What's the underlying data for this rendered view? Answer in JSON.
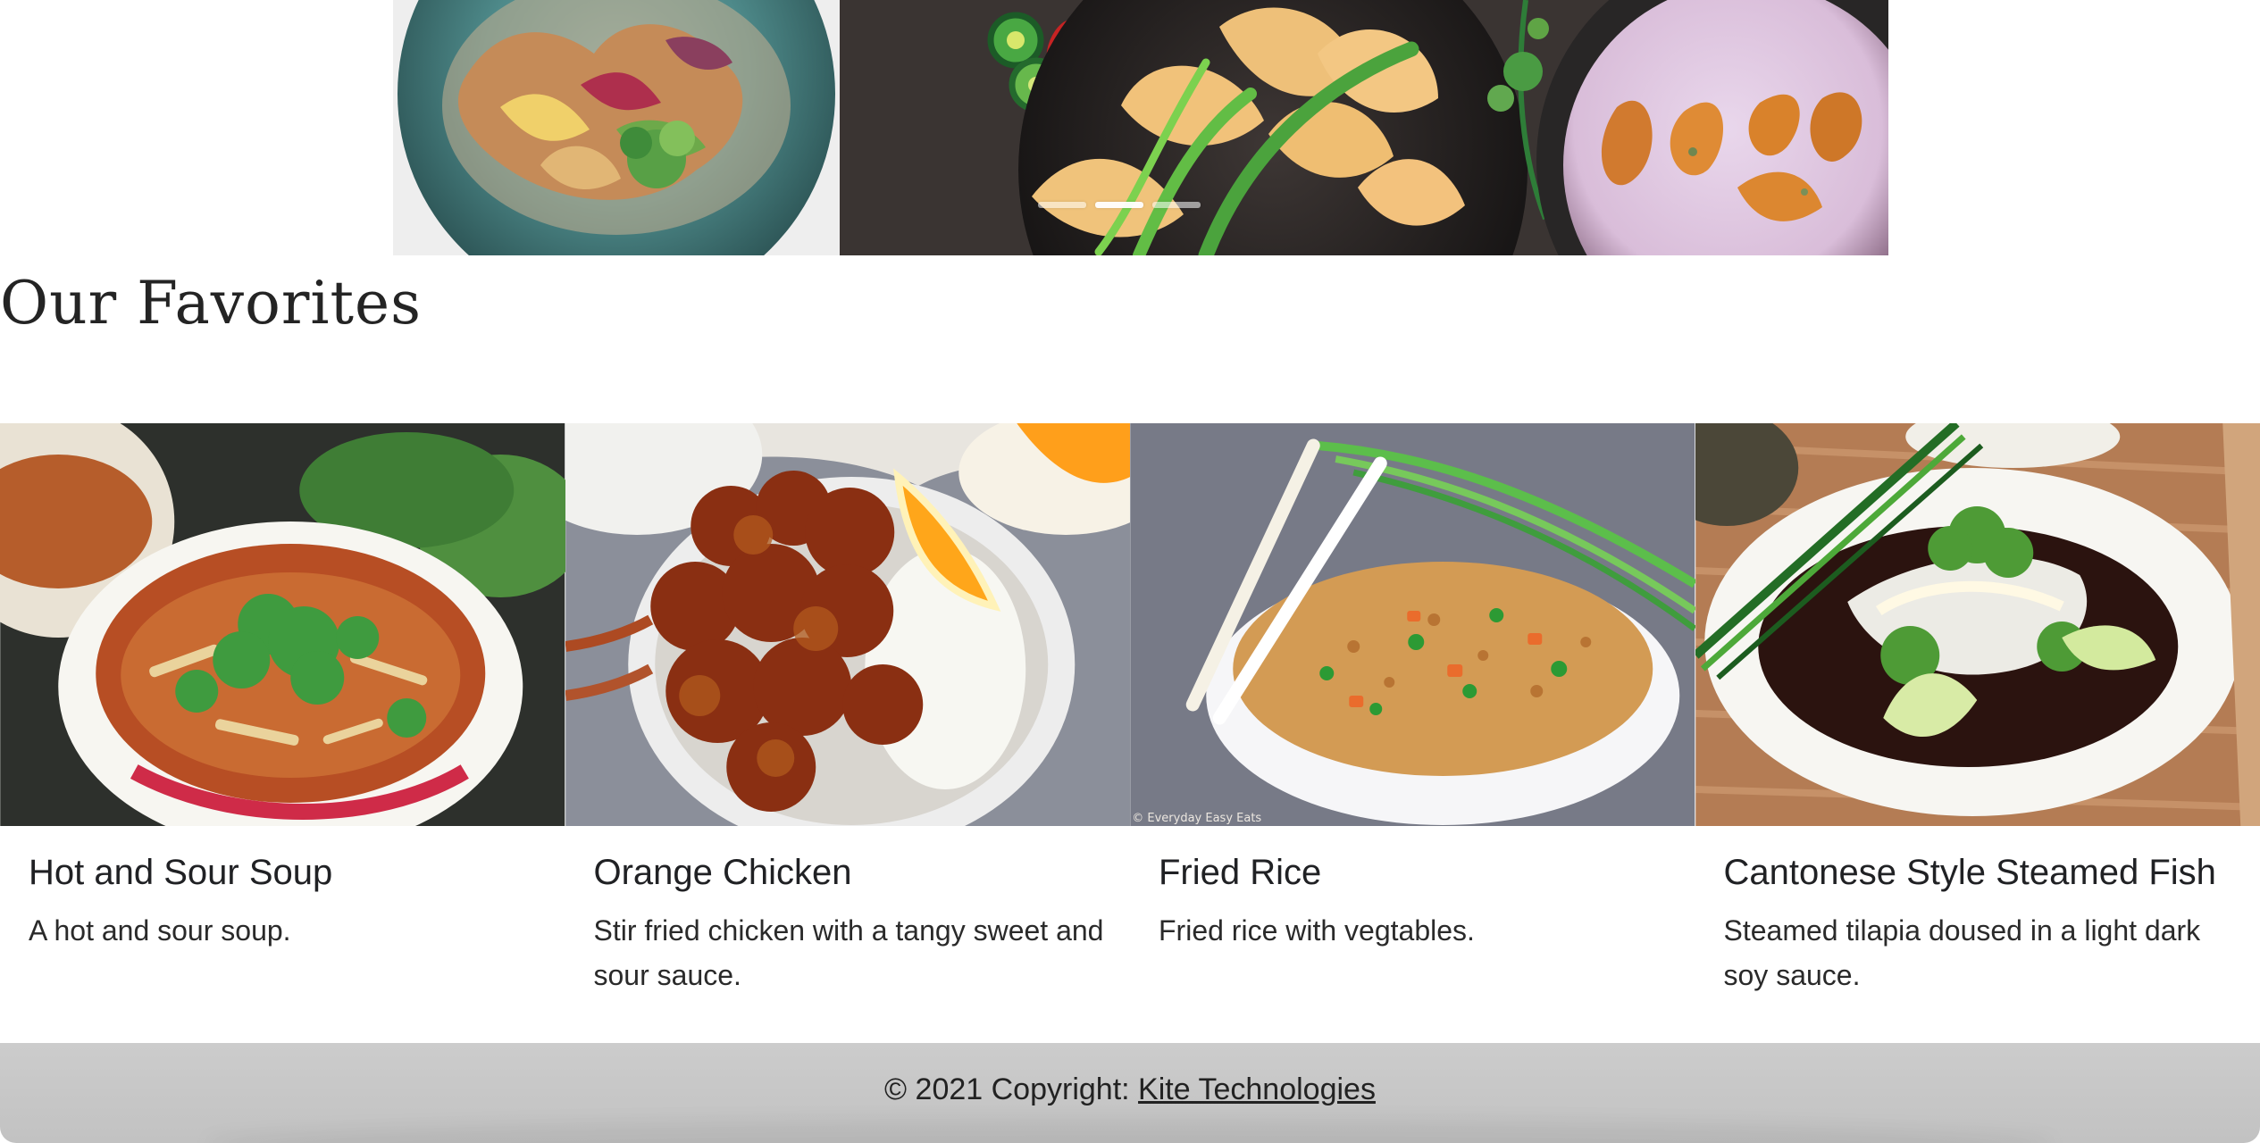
{
  "hero": {
    "indicators": [
      "slide-1",
      "slide-2",
      "slide-3"
    ],
    "active_indicator": 1
  },
  "section": {
    "title": "Our Favorites"
  },
  "cards": [
    {
      "title": "Hot and Sour Soup",
      "description": "A hot and sour soup."
    },
    {
      "title": "Orange Chicken",
      "description": "Stir fried chicken with a tangy sweet and sour sauce."
    },
    {
      "title": "Fried Rice",
      "description": "Fried rice with vegtables.",
      "image_caption": "© Everyday Easy Eats"
    },
    {
      "title": "Cantonese Style Steamed Fish",
      "description": "Steamed tilapia doused in a light dark soy sauce."
    }
  ],
  "footer": {
    "copyright_prefix": "© 2021 Copyright: ",
    "company_link": "Kite Technologies"
  },
  "colors": {
    "footer_background": "#c8c8c8",
    "page_background": "#ffffff",
    "text": "#222222"
  }
}
